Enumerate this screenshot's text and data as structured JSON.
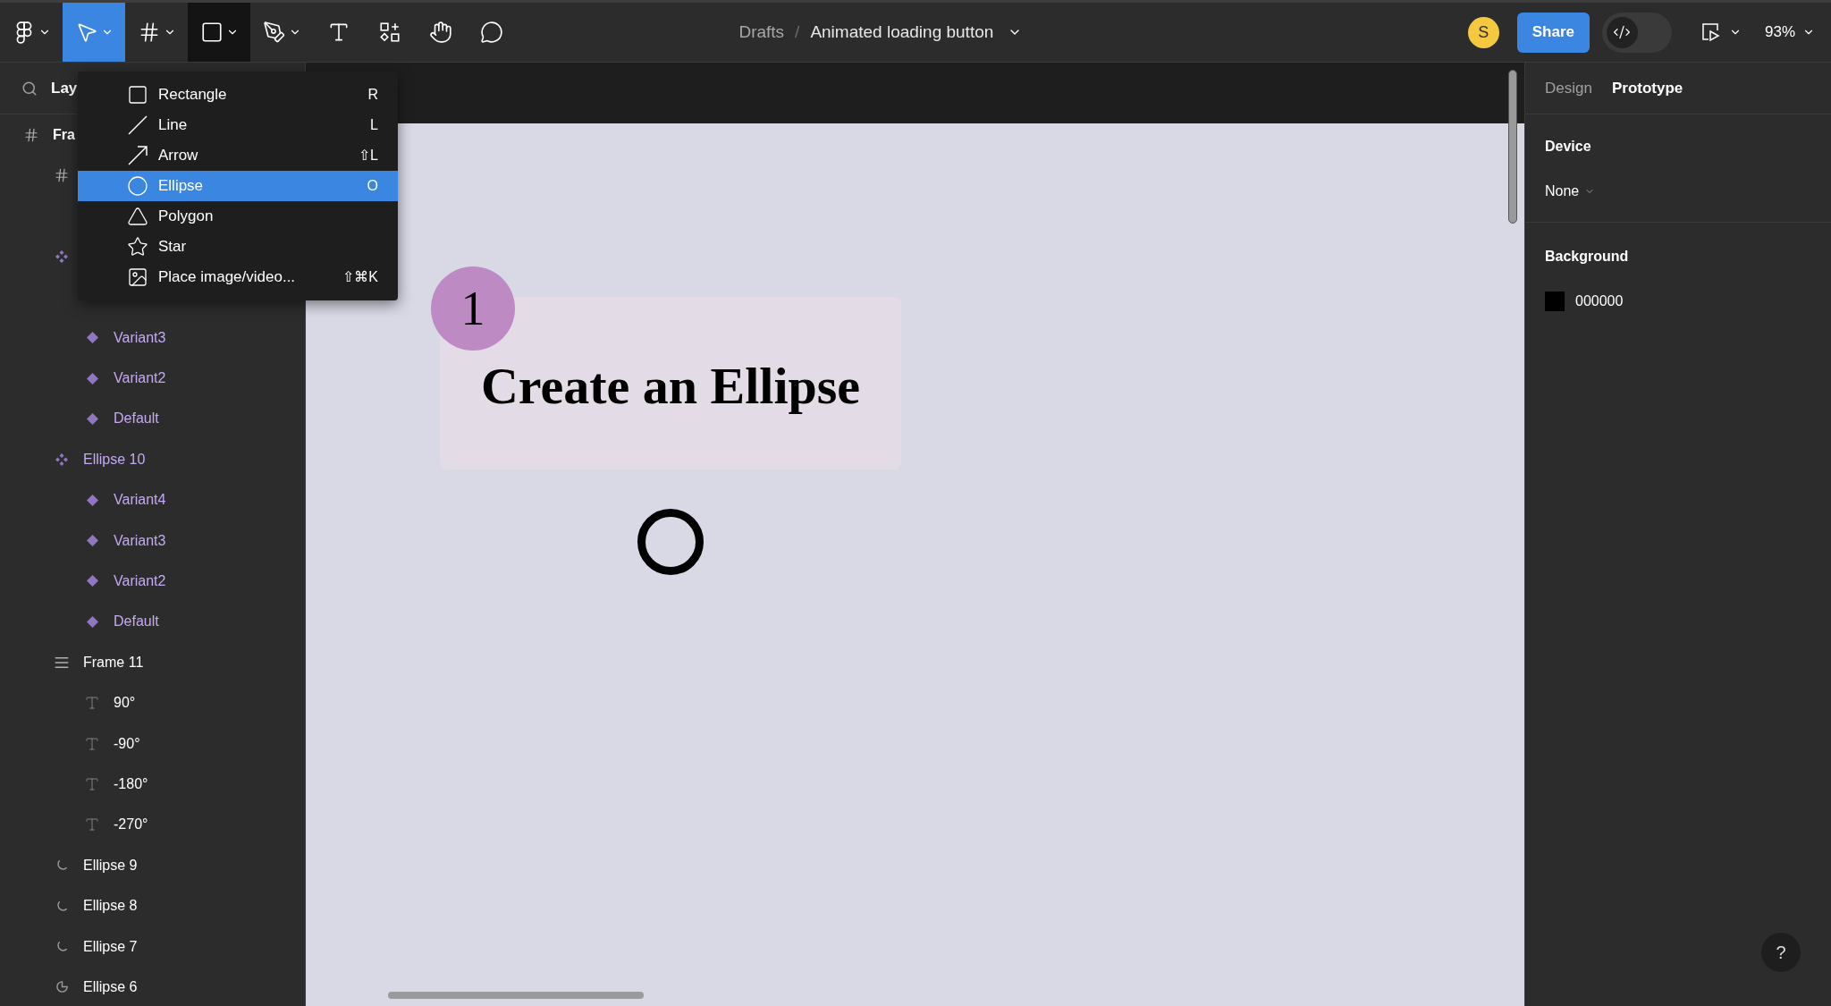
{
  "toolbar": {
    "tools": [
      {
        "kind": "figma",
        "selected": false,
        "expanded": false,
        "has_menu": true
      },
      {
        "kind": "move",
        "selected": true,
        "expanded": false,
        "has_menu": true
      },
      {
        "kind": "frame",
        "selected": false,
        "expanded": false,
        "has_menu": true
      },
      {
        "kind": "shape",
        "selected": false,
        "expanded": true,
        "has_menu": true
      },
      {
        "kind": "pen",
        "selected": false,
        "expanded": false,
        "has_menu": true
      },
      {
        "kind": "text",
        "selected": false,
        "expanded": false,
        "has_menu": false
      },
      {
        "kind": "resources",
        "selected": false,
        "expanded": false,
        "has_menu": false
      },
      {
        "kind": "hand",
        "selected": false,
        "expanded": false,
        "has_menu": false
      },
      {
        "kind": "comment",
        "selected": false,
        "expanded": false,
        "has_menu": false
      }
    ],
    "breadcrumb": {
      "folder": "Drafts",
      "separator": "/",
      "file": "Animated loading button"
    },
    "avatar": {
      "initial": "S",
      "color": "#f5c93f"
    },
    "share": "Share",
    "dev_mode": {
      "on": false
    },
    "zoom": "93%"
  },
  "shape_menu": {
    "items": [
      {
        "kind": "rectangle",
        "label": "Rectangle",
        "shortcut": "R",
        "selected": false
      },
      {
        "kind": "line",
        "label": "Line",
        "shortcut": "L",
        "selected": false
      },
      {
        "kind": "arrow",
        "label": "Arrow",
        "shortcut": "⇧L",
        "selected": false
      },
      {
        "kind": "ellipse",
        "label": "Ellipse",
        "shortcut": "O",
        "selected": true
      },
      {
        "kind": "polygon",
        "label": "Polygon",
        "selected": false
      },
      {
        "kind": "star",
        "label": "Star",
        "selected": false
      },
      {
        "kind": "image",
        "label": "Place image/video...",
        "shortcut": "⇧⌘K",
        "selected": false
      }
    ]
  },
  "layers_panel": {
    "title": "Lay",
    "layers": [
      {
        "kind": "frame",
        "label": "Fra",
        "children": [
          {
            "kind": "frame",
            "children": [
              {
                "kind": "covered"
              }
            ]
          },
          {
            "kind": "component-set",
            "children": [
              {
                "kind": "covered"
              },
              {
                "kind": "variant",
                "label": "Variant3"
              },
              {
                "kind": "variant",
                "label": "Variant2"
              },
              {
                "kind": "variant",
                "label": "Default"
              }
            ]
          },
          {
            "kind": "component-set",
            "label": "Ellipse 10",
            "children": [
              {
                "kind": "variant",
                "label": "Variant4"
              },
              {
                "kind": "variant",
                "label": "Variant3"
              },
              {
                "kind": "variant",
                "label": "Variant2"
              },
              {
                "kind": "variant",
                "label": "Default"
              }
            ]
          },
          {
            "kind": "auto-layout",
            "label": "Frame 11",
            "children": [
              {
                "kind": "text",
                "label": "90°"
              },
              {
                "kind": "text",
                "label": "-90°"
              },
              {
                "kind": "text",
                "label": "-180°"
              },
              {
                "kind": "text",
                "label": "-270°"
              }
            ]
          },
          {
            "kind": "arc",
            "label": "Ellipse 9"
          },
          {
            "kind": "arc",
            "label": "Ellipse 8"
          },
          {
            "kind": "arc",
            "label": "Ellipse 7"
          },
          {
            "kind": "pie",
            "label": "Ellipse 6"
          }
        ]
      }
    ]
  },
  "canvas": {
    "step_number": "1",
    "heading": "Create an Ellipse"
  },
  "properties_panel": {
    "tabs": [
      {
        "label": "Design",
        "selected": false
      },
      {
        "label": "Prototype",
        "selected": true
      }
    ],
    "device": {
      "title": "Device",
      "value": "None"
    },
    "background": {
      "title": "Background",
      "color": "#000000",
      "value": "000000"
    }
  },
  "help": "?"
}
